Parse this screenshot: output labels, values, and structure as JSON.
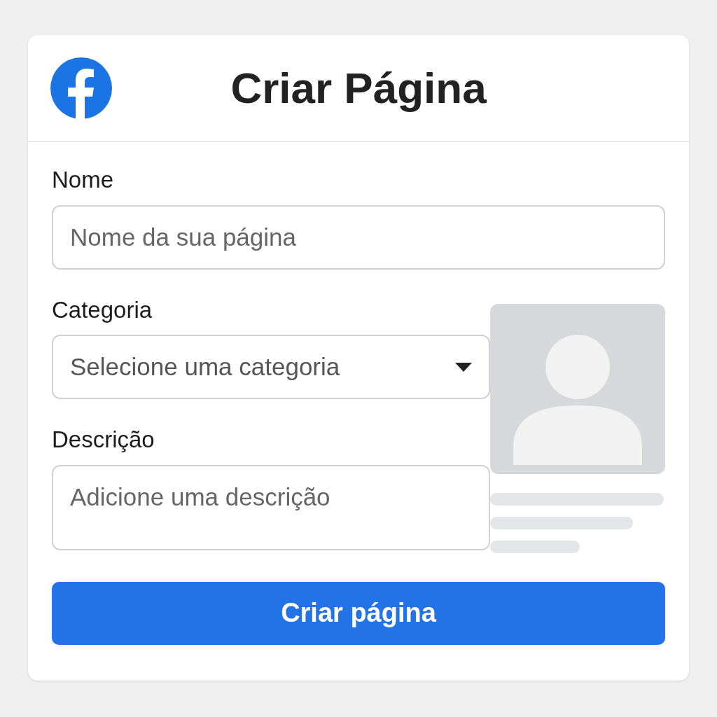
{
  "header": {
    "title": "Criar Página"
  },
  "fields": [
    {
      "kind": "input",
      "label": "Nome",
      "placeholder": "Nome da sua página"
    },
    {
      "kind": "select",
      "label": "Categoria",
      "placeholder": "Selecione uma categoria"
    },
    {
      "kind": "textarea",
      "label": "Descrição",
      "placeholder": "Adicione uma descrição"
    }
  ],
  "submit": {
    "label": "Criar página"
  }
}
